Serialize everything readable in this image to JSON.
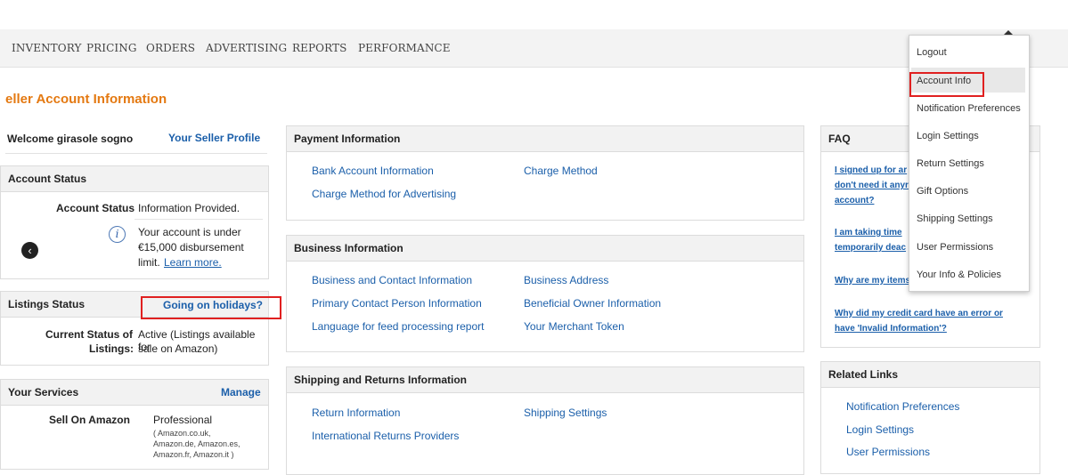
{
  "nav": {
    "items": [
      "INVENTORY",
      "PRICING",
      "ORDERS",
      "ADVERTISING",
      "REPORTS",
      "PERFORMANCE"
    ]
  },
  "page_title": "eller Account Information",
  "welcome": {
    "text": "Welcome girasole sogno",
    "profile_link": "Your Seller Profile"
  },
  "account_status": {
    "title": "Account Status",
    "label": "Account Status",
    "value": "Information Provided.",
    "note_lines": [
      "Your account is under",
      "€15,000 disbursement",
      "limit."
    ],
    "learn_more": "Learn more."
  },
  "listings_status": {
    "title": "Listings Status",
    "holiday_link": "Going on holidays?",
    "label_lines": [
      "Current Status of",
      "Listings:"
    ],
    "value_lines": [
      "Active (Listings available for",
      "sale on Amazon)"
    ]
  },
  "your_services": {
    "title": "Your Services",
    "manage": "Manage",
    "service": "Sell On Amazon",
    "plan": "Professional",
    "markets": [
      "( Amazon.co.uk,",
      "Amazon.de, Amazon.es,",
      "Amazon.fr, Amazon.it )"
    ]
  },
  "payment": {
    "title": "Payment Information",
    "links": [
      "Bank Account Information",
      "Charge Method for Advertising",
      "Charge Method"
    ]
  },
  "business": {
    "title": "Business Information",
    "links": [
      "Business and Contact Information",
      "Primary Contact Person Information",
      "Language for feed processing report",
      "Business Address",
      "Beneficial Owner Information",
      "Your Merchant Token"
    ]
  },
  "shipping": {
    "title": "Shipping and Returns Information",
    "links": [
      "Return Information",
      "International Returns Providers",
      "Shipping Settings"
    ]
  },
  "faq": {
    "title": "FAQ",
    "q1": [
      "I signed up for ar",
      "don't need it anyr",
      "account?"
    ],
    "q2": [
      "I am taking time",
      "temporarily deac"
    ],
    "q3": "Why are my items",
    "q4": [
      "Why did my credit card have an error or",
      "have 'Invalid Information'?"
    ]
  },
  "related": {
    "title": "Related Links",
    "links": [
      "Notification Preferences",
      "Login Settings",
      "User Permissions"
    ]
  },
  "dropdown": {
    "items": [
      "Logout",
      "Account Info",
      "Notification Preferences",
      "Login Settings",
      "Return Settings",
      "Gift Options",
      "Shipping Settings",
      "User Permissions",
      "Your Info & Policies"
    ],
    "highlighted": "Account Info"
  },
  "colors": {
    "title_orange": "#e47911",
    "link_blue": "#1b5faa",
    "highlight_red": "#e02020"
  }
}
